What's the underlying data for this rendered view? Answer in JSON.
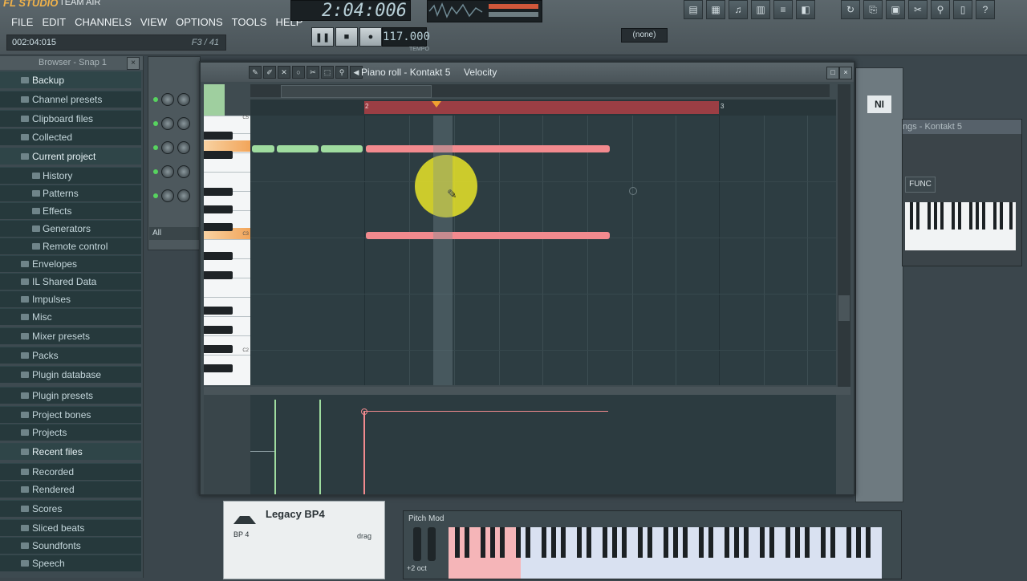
{
  "app": {
    "logo": "FL STUDIO",
    "registered": "TEAM AIR"
  },
  "menu": [
    "FILE",
    "EDIT",
    "CHANNELS",
    "VIEW",
    "OPTIONS",
    "TOOLS",
    "HELP"
  ],
  "hint_bar": {
    "left": "002:04:015",
    "right": "F3 / 41"
  },
  "song_time": "2:04:006",
  "tempo": "117.000",
  "tempo_label": "TEMPO",
  "pattern_none": "(none)",
  "browser": {
    "title": "Browser - Snap 1",
    "items": [
      {
        "label": "Backup",
        "level": 0,
        "highlight": true
      },
      {
        "label": "Channel presets",
        "level": 0
      },
      {
        "label": "Clipboard files",
        "level": 0
      },
      {
        "label": "Collected",
        "level": 0
      },
      {
        "label": "Current project",
        "level": 0,
        "highlight": true
      },
      {
        "label": "History",
        "level": 1
      },
      {
        "label": "Patterns",
        "level": 1
      },
      {
        "label": "Effects",
        "level": 1
      },
      {
        "label": "Generators",
        "level": 1
      },
      {
        "label": "Remote control",
        "level": 1
      },
      {
        "label": "Envelopes",
        "level": 0
      },
      {
        "label": "IL Shared Data",
        "level": 0
      },
      {
        "label": "Impulses",
        "level": 0
      },
      {
        "label": "Misc",
        "level": 0
      },
      {
        "label": "Mixer presets",
        "level": 0
      },
      {
        "label": "Packs",
        "level": 0
      },
      {
        "label": "Plugin database",
        "level": 0
      },
      {
        "label": "Plugin presets",
        "level": 0
      },
      {
        "label": "Project bones",
        "level": 0
      },
      {
        "label": "Projects",
        "level": 0
      },
      {
        "label": "Recent files",
        "level": 0,
        "highlight": true
      },
      {
        "label": "Recorded",
        "level": 0
      },
      {
        "label": "Rendered",
        "level": 0
      },
      {
        "label": "Scores",
        "level": 0
      },
      {
        "label": "Sliced beats",
        "level": 0
      },
      {
        "label": "Soundfonts",
        "level": 0
      },
      {
        "label": "Speech",
        "level": 0
      }
    ]
  },
  "channel_rack": {
    "filter": "All"
  },
  "piano_roll": {
    "title": "Piano roll - Kontakt 5",
    "target": "Velocity",
    "bar_markers": [
      "2",
      "3"
    ],
    "key_labels": {
      "c5": "C5",
      "c3": "C3",
      "c2": "C2"
    }
  },
  "kontakt": {
    "title": "ngs - Kontakt 5",
    "func_label": "FUNC",
    "logo": "NI"
  },
  "legacy": {
    "title": "Legacy BP4",
    "subtitle": "BP 4",
    "drag": "drag"
  },
  "pitch_mod": {
    "label": "Pitch Mod",
    "octave": "+2 oct"
  },
  "colors": {
    "loop": "#9b3e44",
    "note_green": "#9fdc9f",
    "note_red": "#f28a8e",
    "marker": "#f0a030"
  }
}
